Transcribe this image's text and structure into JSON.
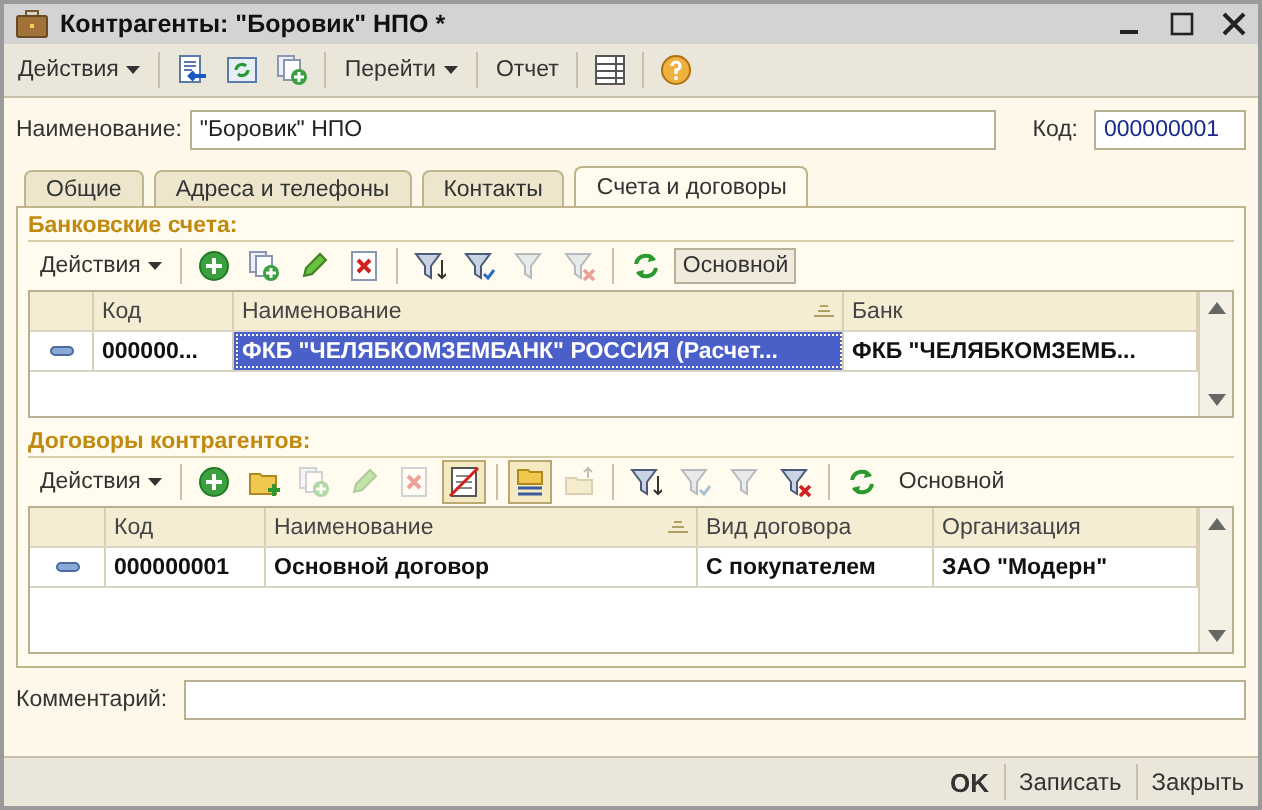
{
  "window": {
    "title": "Контрагенты: \"Боровик\" НПО *"
  },
  "toolbar": [
    {
      "kind": "menu",
      "label": "Действия"
    },
    {
      "kind": "sep"
    },
    {
      "kind": "doc-arrow",
      "disabled": false,
      "pressed": false
    },
    {
      "kind": "refresh-doc",
      "disabled": false,
      "pressed": false
    },
    {
      "kind": "copy-add",
      "disabled": false,
      "pressed": false
    },
    {
      "kind": "sep"
    },
    {
      "kind": "menu",
      "label": "Перейти"
    },
    {
      "kind": "sep"
    },
    {
      "kind": "text",
      "label": "Отчет",
      "pressed": false
    },
    {
      "kind": "sep"
    },
    {
      "kind": "list",
      "disabled": false,
      "pressed": false
    },
    {
      "kind": "sep"
    },
    {
      "kind": "help",
      "disabled": false,
      "pressed": false
    }
  ],
  "name_field": {
    "label": "Наименование:",
    "value": "\"Боровик\" НПО"
  },
  "code_field": {
    "label": "Код:",
    "value": "000000001"
  },
  "tabs": [
    {
      "label": "Общие",
      "selected": false
    },
    {
      "label": "Адреса и телефоны",
      "selected": false
    },
    {
      "label": "Контакты",
      "selected": false
    },
    {
      "label": "Счета и договоры",
      "selected": true
    }
  ],
  "bank_accounts": {
    "title": "Банковские счета:",
    "toolbar": [
      {
        "kind": "menu",
        "label": "Действия"
      },
      {
        "kind": "sep"
      },
      {
        "kind": "add",
        "disabled": false,
        "pressed": false
      },
      {
        "kind": "copy-add",
        "disabled": false,
        "pressed": false
      },
      {
        "kind": "edit",
        "disabled": false,
        "pressed": false
      },
      {
        "kind": "delete",
        "disabled": false,
        "pressed": false
      },
      {
        "kind": "sep"
      },
      {
        "kind": "filter-set",
        "disabled": false,
        "pressed": false
      },
      {
        "kind": "filter-pick",
        "disabled": false,
        "pressed": false
      },
      {
        "kind": "filter-menu",
        "disabled": true,
        "pressed": false
      },
      {
        "kind": "filter-clear",
        "disabled": true,
        "pressed": false
      },
      {
        "kind": "sep"
      },
      {
        "kind": "refresh",
        "disabled": false,
        "pressed": false
      },
      {
        "kind": "text",
        "label": "Основной",
        "pressed": true
      }
    ],
    "columns": [
      "Код",
      "Наименование",
      "Банк"
    ],
    "rows": [
      {
        "cells": [
          {
            "text": "000000...",
            "selected": false
          },
          {
            "text": "ФКБ \"ЧЕЛЯБКОМЗЕМБАНК\"  РОССИЯ (Расчет...",
            "selected": true
          },
          {
            "text": "ФКБ \"ЧЕЛЯБКОМЗЕМБ...",
            "selected": false
          }
        ]
      }
    ]
  },
  "contracts": {
    "title": "Договоры контрагентов:",
    "toolbar": [
      {
        "kind": "menu",
        "label": "Действия"
      },
      {
        "kind": "sep"
      },
      {
        "kind": "add",
        "disabled": false,
        "pressed": false
      },
      {
        "kind": "folder-add",
        "disabled": false,
        "pressed": false
      },
      {
        "kind": "copy-add",
        "disabled": true,
        "pressed": false
      },
      {
        "kind": "edit",
        "disabled": true,
        "pressed": false
      },
      {
        "kind": "delete",
        "disabled": true,
        "pressed": false
      },
      {
        "kind": "no-tree",
        "disabled": false,
        "pressed": true
      },
      {
        "kind": "sep"
      },
      {
        "kind": "folder-tree",
        "disabled": false,
        "pressed": true
      },
      {
        "kind": "parent-up",
        "disabled": true,
        "pressed": false
      },
      {
        "kind": "sep"
      },
      {
        "kind": "filter-set",
        "disabled": false,
        "pressed": false
      },
      {
        "kind": "filter-pick",
        "disabled": true,
        "pressed": false
      },
      {
        "kind": "filter-menu",
        "disabled": true,
        "pressed": false
      },
      {
        "kind": "filter-clear",
        "disabled": false,
        "pressed": false
      },
      {
        "kind": "sep"
      },
      {
        "kind": "refresh",
        "disabled": false,
        "pressed": false
      },
      {
        "kind": "text",
        "label": "Основной",
        "pressed": false
      }
    ],
    "columns": [
      "Код",
      "Наименование",
      "Вид договора",
      "Организация"
    ],
    "rows": [
      {
        "cells": [
          {
            "text": "000000001",
            "selected": false
          },
          {
            "text": "Основной договор",
            "selected": false
          },
          {
            "text": "С покупателем",
            "selected": false
          },
          {
            "text": "ЗАО \"Модерн\"",
            "selected": false
          }
        ]
      }
    ]
  },
  "comment_field": {
    "label": "Комментарий:"
  },
  "buttons": [
    {
      "label": "OK",
      "default": true
    },
    {
      "label": "Записать",
      "default": false
    },
    {
      "label": "Закрыть",
      "default": false
    }
  ]
}
